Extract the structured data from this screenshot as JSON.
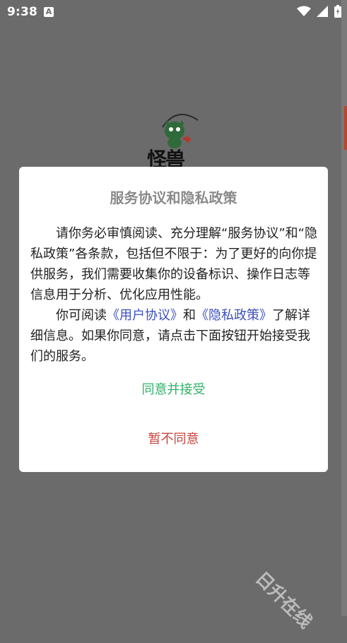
{
  "status_bar": {
    "time": "9:38",
    "notification_icon": "a-letter-icon",
    "wifi_icon": "wifi-icon",
    "signal_icon": "signal-icon",
    "battery_icon": "battery-charging-icon"
  },
  "background": {
    "logo_text": "怪兽"
  },
  "dialog": {
    "title": "服务协议和隐私政策",
    "paragraph1": "请你务必审慎阅读、充分理解“服务协议”和“隐私政策”各条款，包括但不限于：为了更好的向你提供服务，我们需要收集你的设备标识、操作日志等信息用于分析、优化应用性能。",
    "paragraph2_prefix": "你可阅读",
    "user_agreement_link": "《用户协议》",
    "paragraph2_and": "和",
    "privacy_policy_link": "《隐私政策》",
    "paragraph2_suffix": "了解详细信息。如果你同意，请点击下面按钮开始接受我们的服务。",
    "accept_label": "同意并接受",
    "decline_label": "暂不同意"
  },
  "watermark": {
    "text": "日升在线"
  },
  "colors": {
    "accept": "#2fb168",
    "decline": "#c9453f",
    "link": "#3b4fbf",
    "overlay": "#6b6b6b"
  }
}
